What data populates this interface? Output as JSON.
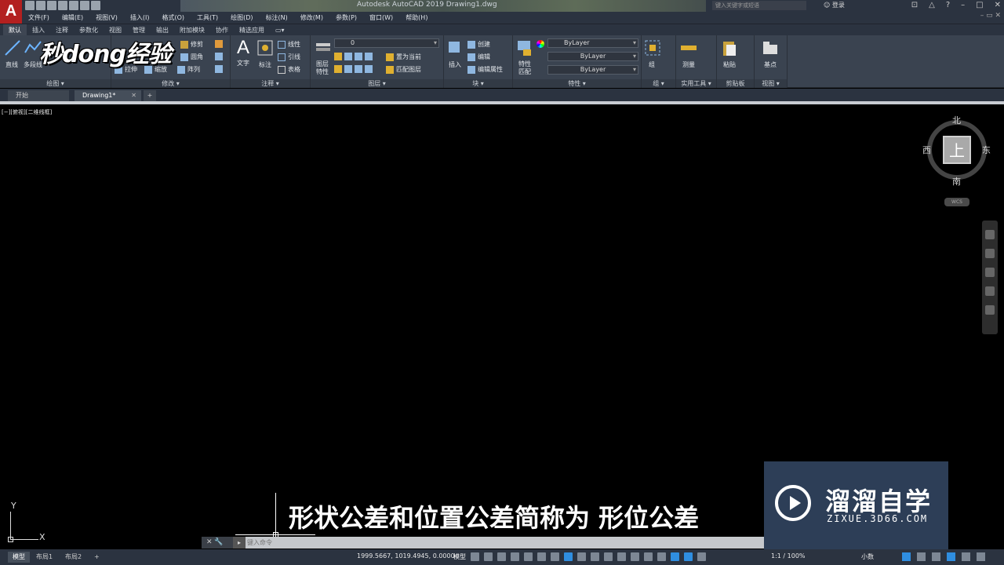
{
  "window": {
    "title": "Autodesk AutoCAD 2019    Drawing1.dwg",
    "app_logo": "A",
    "search_placeholder": "键入关键字或短语",
    "login_label": "登录"
  },
  "watermark_logo": "秒dong经验",
  "menu": [
    "文件(F)",
    "编辑(E)",
    "视图(V)",
    "插入(I)",
    "格式(O)",
    "工具(T)",
    "绘图(D)",
    "标注(N)",
    "修改(M)",
    "参数(P)",
    "窗口(W)",
    "帮助(H)"
  ],
  "ribbon_tabs": [
    "默认",
    "插入",
    "注释",
    "参数化",
    "视图",
    "管理",
    "输出",
    "附加模块",
    "协作",
    "精选应用"
  ],
  "ribbon": {
    "draw": {
      "title": "绘图",
      "line": "直线",
      "polyline": "多段线"
    },
    "modify": {
      "title": "修改",
      "trim": "修剪",
      "fillet": "圆角",
      "array": "阵列",
      "stretch": "拉伸",
      "scale": "缩放"
    },
    "annotation": {
      "title": "注释",
      "text": "文字",
      "dim": "标注",
      "linear": "线性",
      "leader": "引线",
      "table": "表格"
    },
    "layers": {
      "title": "图层",
      "layer_props": "图层\n特性",
      "layer_value": "0",
      "make_current": "置为当前",
      "match_layer": "匹配图层"
    },
    "block": {
      "title": "块",
      "insert": "插入",
      "create": "创建",
      "edit": "编辑",
      "edit_attr": "编辑属性"
    },
    "properties": {
      "title": "特性",
      "match_props": "特性\n匹配",
      "color": "ByLayer",
      "linetype": "ByLayer",
      "lineweight": "ByLayer"
    },
    "groups": {
      "title": "组",
      "group": "组"
    },
    "utilities": {
      "title": "实用工具",
      "measure": "测量"
    },
    "clipboard": {
      "title": "剪贴板",
      "paste": "粘贴"
    },
    "view": {
      "title": "视图",
      "base": "基点"
    }
  },
  "file_tabs": {
    "start": "开始",
    "drawing": "Drawing1*"
  },
  "viewport": {
    "label": "[−][俯视][二维线框]",
    "viewcube": {
      "face": "上",
      "north": "北",
      "south": "南",
      "east": "东",
      "west": "西",
      "wcs": "WCS"
    },
    "ucs": {
      "x": "X",
      "y": "Y"
    }
  },
  "subtitle": "形状公差和位置公差简称为 形位公差",
  "brand": {
    "cn": "溜溜自学",
    "en": "ZIXUE.3D66.COM"
  },
  "command_line": {
    "placeholder": "键入命令"
  },
  "statusbar": {
    "tabs": [
      "模型",
      "布局1",
      "布局2",
      "+"
    ],
    "coords": "1999.5667, 1019.4945, 0.0000",
    "model": "模型",
    "scale": "1:1 / 100%",
    "units": "小数"
  },
  "colors": {
    "accent": "#2f8ee0",
    "app_logo": "#b32020",
    "brand_bg": "#2d3e57"
  }
}
